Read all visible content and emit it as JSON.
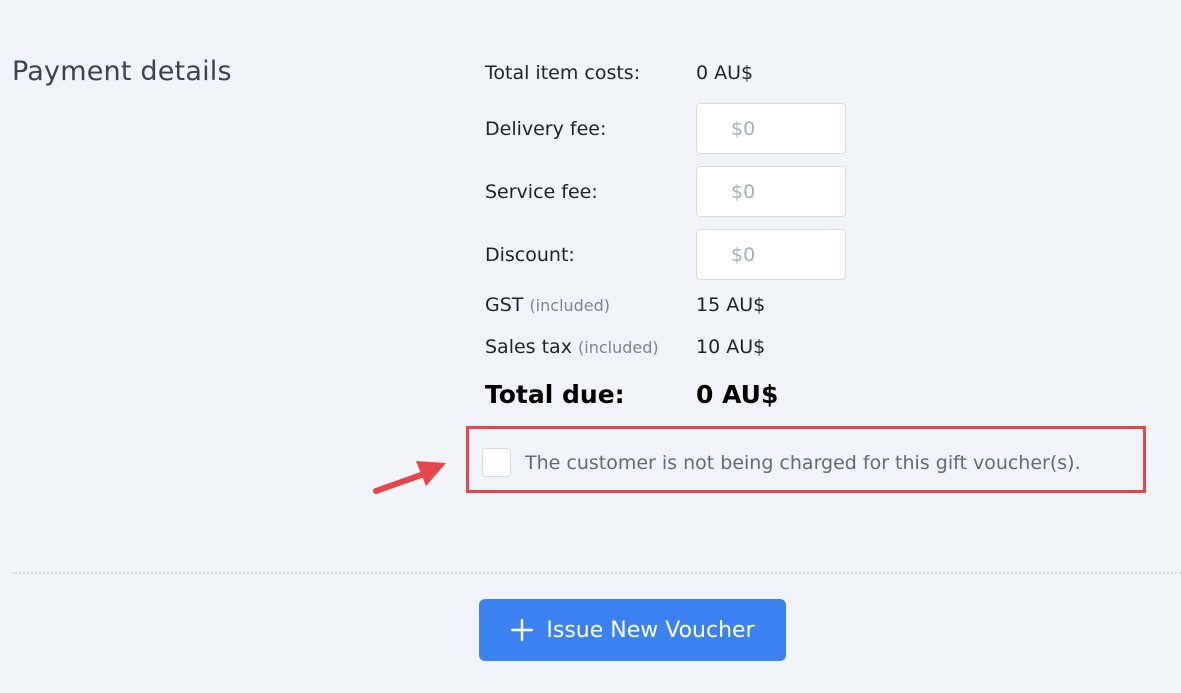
{
  "payment": {
    "title": "Payment details",
    "total_item_costs": {
      "label": "Total item costs:",
      "value": "0 AU$"
    },
    "delivery_fee": {
      "label": "Delivery fee:",
      "placeholder": "$0"
    },
    "service_fee": {
      "label": "Service fee:",
      "placeholder": "$0"
    },
    "discount": {
      "label": "Discount:",
      "placeholder": "$0"
    },
    "gst": {
      "label": "GST",
      "note": "(included)",
      "value": "15 AU$"
    },
    "sales_tax": {
      "label": "Sales tax",
      "note": "(included)",
      "value": "10 AU$"
    },
    "total_due": {
      "label": "Total due:",
      "value": "0 AU$"
    },
    "no_charge_checkbox": {
      "label": "The customer is not being charged for this gift voucher(s).",
      "checked": false
    }
  },
  "annotation": {
    "arrow_color": "#e3474a",
    "box_color": "#e3474a"
  },
  "actions": {
    "issue_button_label": "Issue New Voucher",
    "issue_button_icon": "plus-icon",
    "accent_color": "#3b82f0"
  }
}
